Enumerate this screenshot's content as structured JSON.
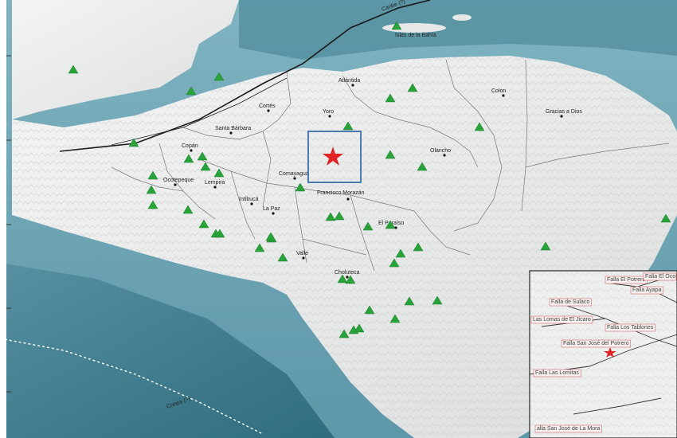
{
  "map": {
    "features": {
      "trench": "Cresta (?)",
      "caribbean": "Caribe (?)",
      "islands": "Islas de la Bahía"
    },
    "departments": [
      {
        "name": "Atlántida"
      },
      {
        "name": "Colon"
      },
      {
        "name": "Cortés"
      },
      {
        "name": "Yoro"
      },
      {
        "name": "Gracias a Dios"
      },
      {
        "name": "Santa Bárbara"
      },
      {
        "name": "Copán"
      },
      {
        "name": "Olancho"
      },
      {
        "name": "Ocotepeque"
      },
      {
        "name": "Lempira"
      },
      {
        "name": "Comayagua"
      },
      {
        "name": "Intibucá"
      },
      {
        "name": "Francisco Morazán"
      },
      {
        "name": "La Paz"
      },
      {
        "name": "El Paraíso"
      },
      {
        "name": "Valle"
      },
      {
        "name": "Choluteca"
      }
    ],
    "faults": [
      {
        "name": "Falla El Potrero"
      },
      {
        "name": "Falla El Oco"
      },
      {
        "name": "Falla Ayapa"
      },
      {
        "name": "Falla de Sulaco"
      },
      {
        "name": "Las Lomas de El Jicaro"
      },
      {
        "name": "Falla Los Tablones"
      },
      {
        "name": "Falla San José del Potrero"
      },
      {
        "name": "Falla Las Lomitas"
      },
      {
        "name": "alla San José de La Mora"
      }
    ],
    "station_count": 47,
    "colors": {
      "sea": "#6fa7b6",
      "deep_sea": "#3f7d8e",
      "land": "#e9eaea",
      "station": "#27a33a",
      "epicenter": "#e22424",
      "study_box": "#3a6ea8"
    },
    "icons": {
      "station": "green-triangle-icon",
      "epicenter": "red-star-icon"
    }
  }
}
